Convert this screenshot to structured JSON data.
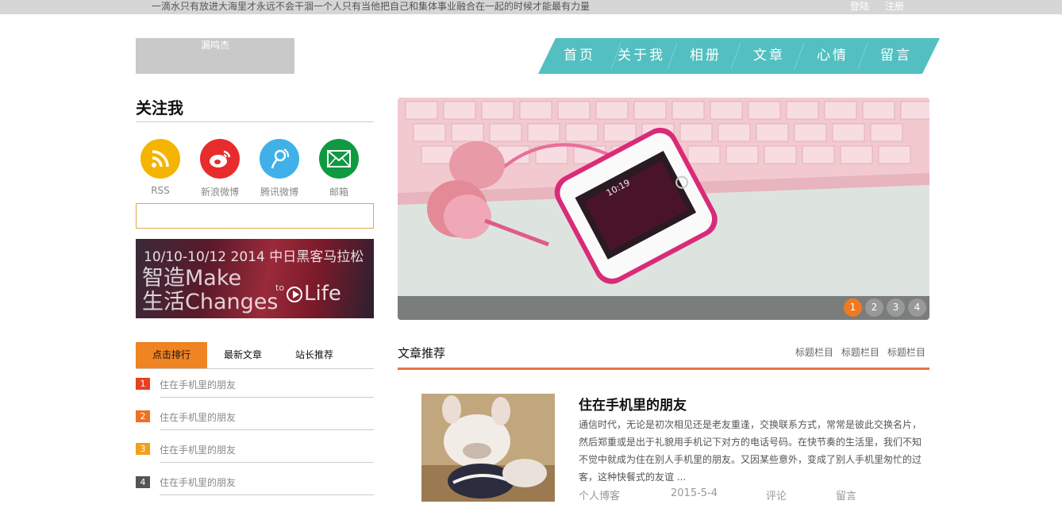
{
  "topbar": {
    "slogan": "一滴水只有放进大海里才永远不会干涸一个人只有当他把自己和集体事业融合在一起的时候才能最有力量",
    "login": "登陆",
    "register": "注册"
  },
  "logo": {
    "text": "漏鸣杰"
  },
  "nav": {
    "color": "#53bfc0",
    "items": [
      "首页",
      "关于我",
      "相册",
      "文章",
      "心情",
      "留言"
    ]
  },
  "sidebar": {
    "follow_title": "关注我",
    "social": [
      {
        "label": "RSS",
        "icon": "rss-icon",
        "color": "#f5b400"
      },
      {
        "label": "新浪微博",
        "icon": "weibo-icon",
        "color": "#e82b2b"
      },
      {
        "label": "腾讯微博",
        "icon": "tencent-weibo-icon",
        "color": "#3fb1e8"
      },
      {
        "label": "邮箱",
        "icon": "mail-icon",
        "color": "#0f9a41"
      }
    ],
    "search": {
      "placeholder": ""
    },
    "banner": {
      "line1": "10/10-10/12  2014 中日黑客马拉松",
      "line2": "智造Make",
      "line3": "生活Changes",
      "to": "to",
      "life": "Life"
    },
    "tabs": [
      "点击排行",
      "最新文章",
      "站长推荐"
    ],
    "ranks": [
      {
        "num": "1",
        "text": "住在手机里的朋友",
        "color": "#e8411e"
      },
      {
        "num": "2",
        "text": "住在手机里的朋友",
        "color": "#f07022"
      },
      {
        "num": "3",
        "text": "住在手机里的朋友",
        "color": "#f0a022"
      },
      {
        "num": "4",
        "text": "住在手机里的朋友",
        "color": "#555555"
      }
    ]
  },
  "slider": {
    "dots": [
      "1",
      "2",
      "3",
      "4"
    ],
    "active_dot": "1",
    "phone_time": "10:19"
  },
  "articles_section": {
    "title": "文章推荐",
    "links": [
      "标题栏目",
      "标题栏目",
      "标题栏目"
    ]
  },
  "article": {
    "title": "住在手机里的朋友",
    "body": "通信时代，无论是初次相见还是老友重逢，交换联系方式，常常是彼此交换名片，然后郑重或是出于礼貌用手机记下对方的电话号码。在快节奏的生活里，我们不知不觉中就成为住在别人手机里的朋友。又因某些意外，变成了别人手机里匆忙的过客，这种快餐式的友谊 ...",
    "author": "个人博客",
    "date": "2015-5-4",
    "comment": "评论",
    "message": "留言"
  }
}
